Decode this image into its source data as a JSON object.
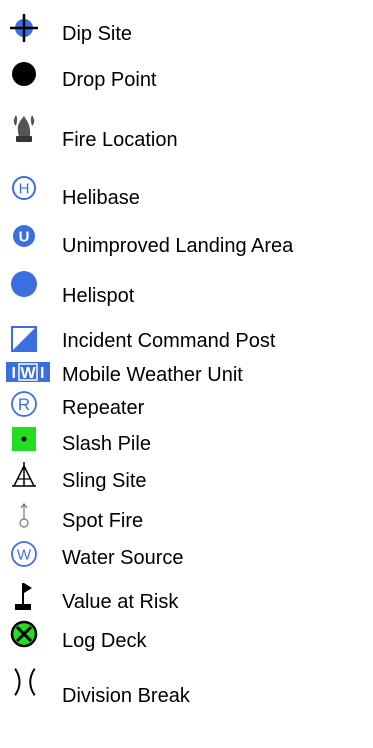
{
  "legend": {
    "items": [
      {
        "label": "Dip Site",
        "icon": "dip-site-icon"
      },
      {
        "label": "Drop Point",
        "icon": "drop-point-icon"
      },
      {
        "label": "Fire Location",
        "icon": "fire-location-icon"
      },
      {
        "label": "Helibase",
        "icon": "helibase-icon"
      },
      {
        "label": "Unimproved Landing Area",
        "icon": "unimproved-landing-area-icon"
      },
      {
        "label": "Helispot",
        "icon": "helispot-icon"
      },
      {
        "label": "Incident Command Post",
        "icon": "incident-command-post-icon"
      },
      {
        "label": "Mobile Weather Unit",
        "icon": "mobile-weather-unit-icon"
      },
      {
        "label": "Repeater",
        "icon": "repeater-icon"
      },
      {
        "label": "Slash Pile",
        "icon": "slash-pile-icon"
      },
      {
        "label": "Sling Site",
        "icon": "sling-site-icon"
      },
      {
        "label": "Spot Fire",
        "icon": "spot-fire-icon"
      },
      {
        "label": "Water Source",
        "icon": "water-source-icon"
      },
      {
        "label": "Value at Risk",
        "icon": "value-at-risk-icon"
      },
      {
        "label": "Log Deck",
        "icon": "log-deck-icon"
      },
      {
        "label": "Division Break",
        "icon": "division-break-icon"
      }
    ],
    "colors": {
      "blue": "#3b6fe0",
      "green": "#22dd22",
      "black": "#000000",
      "gray": "#555555"
    }
  }
}
